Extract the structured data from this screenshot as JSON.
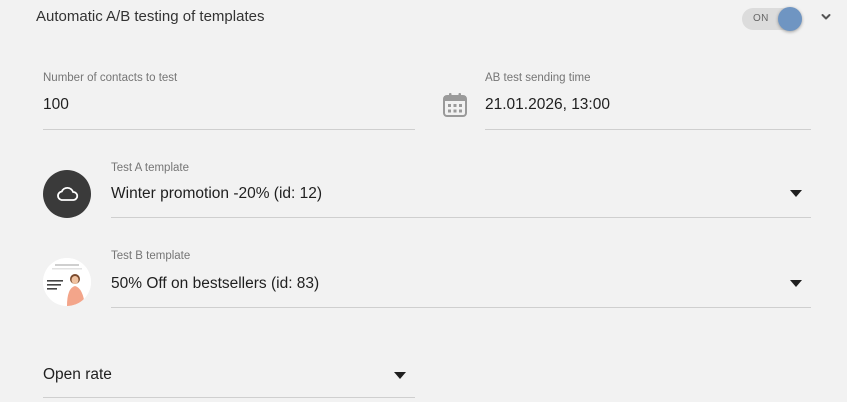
{
  "header": {
    "title": "Automatic A/B testing of templates",
    "toggle_label": "ON",
    "toggle_on": true,
    "accent_color": "#6f95c2"
  },
  "contacts": {
    "label": "Number of contacts to test",
    "value": "100"
  },
  "send_time": {
    "label": "AB test sending time",
    "value": "21.01.2026, 13:00",
    "icon": "calendar-icon"
  },
  "template_a": {
    "label": "Test A template",
    "value": "Winter promotion -20% (id: 12)",
    "icon": "cloud-icon"
  },
  "template_b": {
    "label": "Test B template",
    "value": "50% Off on bestsellers (id: 83)",
    "icon": "template-thumbnail"
  },
  "metric": {
    "value": "Open rate"
  }
}
